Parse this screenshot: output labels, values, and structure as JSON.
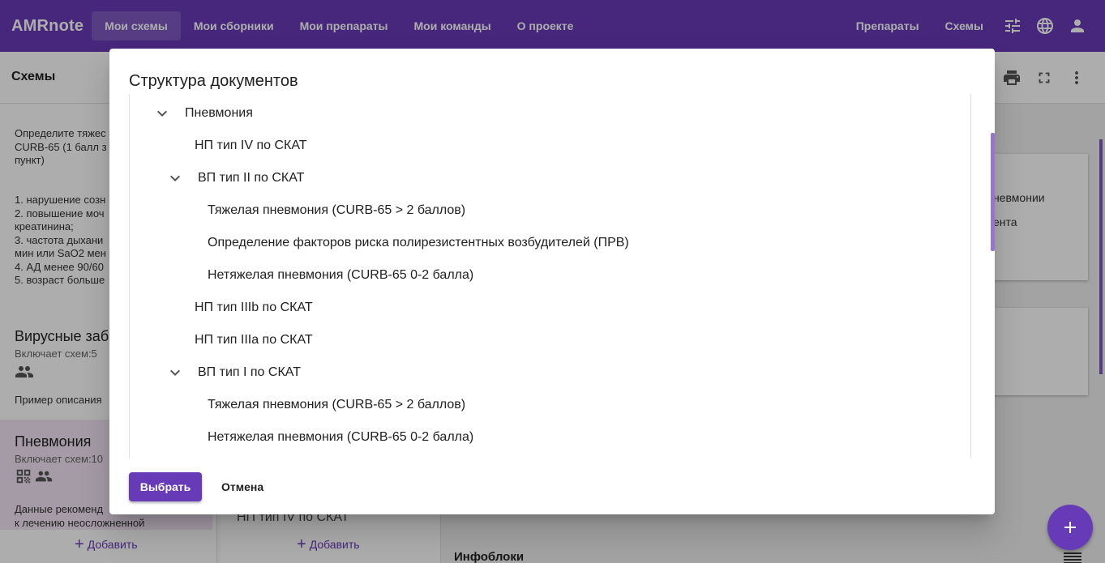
{
  "app": {
    "brand": "AMRnote"
  },
  "nav": [
    {
      "label": "Мои схемы",
      "active": true
    },
    {
      "label": "Мои сборники",
      "active": false
    },
    {
      "label": "Мои препараты",
      "active": false
    },
    {
      "label": "Мои команды",
      "active": false
    },
    {
      "label": "О проекте",
      "active": false
    }
  ],
  "topbar_right": {
    "links": [
      "Препараты",
      "Схемы"
    ],
    "icons": [
      "tune-icon",
      "globe-icon",
      "account-icon"
    ]
  },
  "background": {
    "section_title": "Схемы",
    "card1_text": "Определите тяжес\nCURB-65 (1 балл з\nпункт)",
    "card1_list": "1. нарушение созн\n2. повышение моч\nкреатинина;\n3. частота дыхани\nмин или SaO2 мен\n4. АД менее 90/60\n5. возраст больше",
    "card2_title": "Вирусные заб",
    "card2_sub": "Включает схем:5",
    "card2_text": "Пример описания",
    "card3_title": "Пневмония",
    "card3_sub": "Включает схем:10",
    "card3_text": "Данные рекоменд\nк лечению неосложненной",
    "add_label": "Добавить",
    "mid_item": "НП тип IV по СКАТ",
    "right_text1": "невмонии",
    "right_text2": "ента",
    "infoblocks_label": "Инфоблоки"
  },
  "dialog": {
    "title": "Структура документов",
    "tree": [
      {
        "label": "Пневмония",
        "level": 0,
        "expandable": true
      },
      {
        "label": "НП тип IV по СКАТ",
        "level": 1,
        "expandable": false
      },
      {
        "label": "ВП тип II по СКАТ",
        "level": 1,
        "expandable": true
      },
      {
        "label": "Тяжелая пневмония (CURB-65 > 2 баллов)",
        "level": 2,
        "expandable": false
      },
      {
        "label": "Определение факторов риска полирезистентных возбудителей (ПРВ)",
        "level": 2,
        "expandable": false
      },
      {
        "label": "Нетяжелая пневмония (CURB-65 0-2 балла)",
        "level": 2,
        "expandable": false
      },
      {
        "label": "НП тип IIIb по СКАТ",
        "level": 1,
        "expandable": false
      },
      {
        "label": "НП тип IIIa по СКАТ",
        "level": 1,
        "expandable": false
      },
      {
        "label": "ВП тип I по СКАТ",
        "level": 1,
        "expandable": true
      },
      {
        "label": "Тяжелая пневмония (CURB-65 > 2 баллов)",
        "level": 2,
        "expandable": false
      },
      {
        "label": "Нетяжелая пневмония (CURB-65 0-2 балла)",
        "level": 2,
        "expandable": false
      }
    ],
    "select_label": "Выбрать",
    "cancel_label": "Отмена"
  },
  "colors": {
    "primary": "#673ab7",
    "selected_card": "#f3e5f5"
  }
}
